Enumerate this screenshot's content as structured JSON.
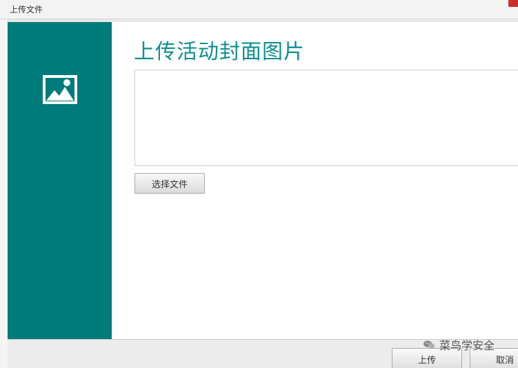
{
  "window": {
    "title": "上传文件"
  },
  "sidebar": {
    "icon": "image-icon",
    "background": "#007b7b"
  },
  "main": {
    "title": "上传活动封面图片",
    "choose_file_label": "选择文件"
  },
  "footer": {
    "upload_label": "上传",
    "cancel_label": "取消"
  },
  "watermark": {
    "text": "菜鸟学安全"
  },
  "colors": {
    "accent": "#0f8f8f",
    "sidebar": "#007b7b"
  }
}
